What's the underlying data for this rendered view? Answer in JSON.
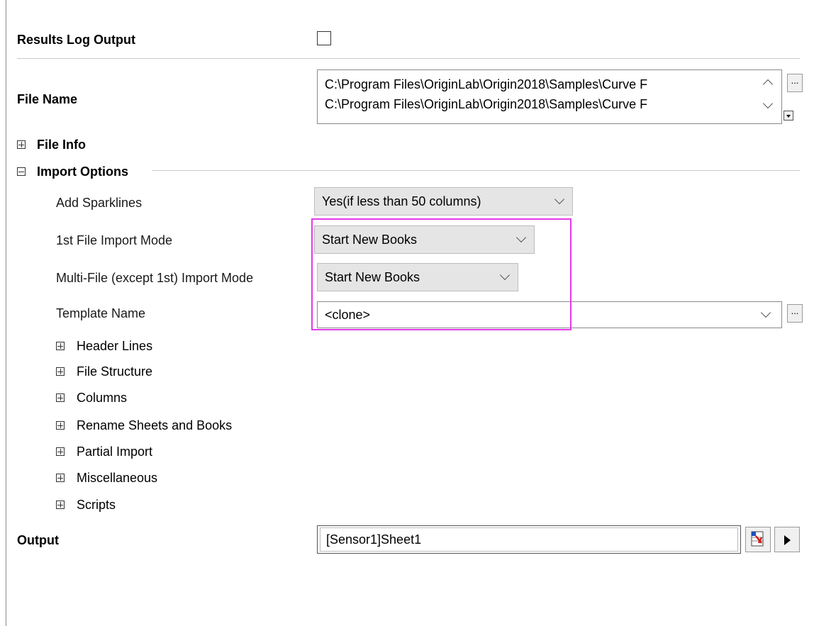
{
  "results_log": {
    "label": "Results Log Output",
    "checked": false
  },
  "file_name": {
    "label": "File Name",
    "lines": [
      "C:\\Program Files\\OriginLab\\Origin2018\\Samples\\Curve F",
      "C:\\Program Files\\OriginLab\\Origin2018\\Samples\\Curve F"
    ],
    "browse_label": "..."
  },
  "file_info": {
    "label": "File Info"
  },
  "import_options": {
    "label": "Import Options",
    "add_sparklines": {
      "label": "Add Sparklines",
      "value": "Yes(if less than 50 columns)"
    },
    "first_import_mode": {
      "label": "1st File Import Mode",
      "value": "Start New Books"
    },
    "multi_import_mode": {
      "label": "Multi-File (except 1st) Import Mode",
      "value": "Start New Books"
    },
    "template_name": {
      "label": "Template Name",
      "value": "<clone>",
      "browse_label": "..."
    },
    "subsections": [
      "Header Lines",
      "File Structure",
      "Columns",
      "Rename Sheets and Books",
      "Partial Import",
      "Miscellaneous",
      "Scripts"
    ]
  },
  "output": {
    "label": "Output",
    "value": "[Sensor1]Sheet1"
  },
  "colors": {
    "highlight": "#e23be6",
    "combo_bg": "#e5e5e5"
  }
}
